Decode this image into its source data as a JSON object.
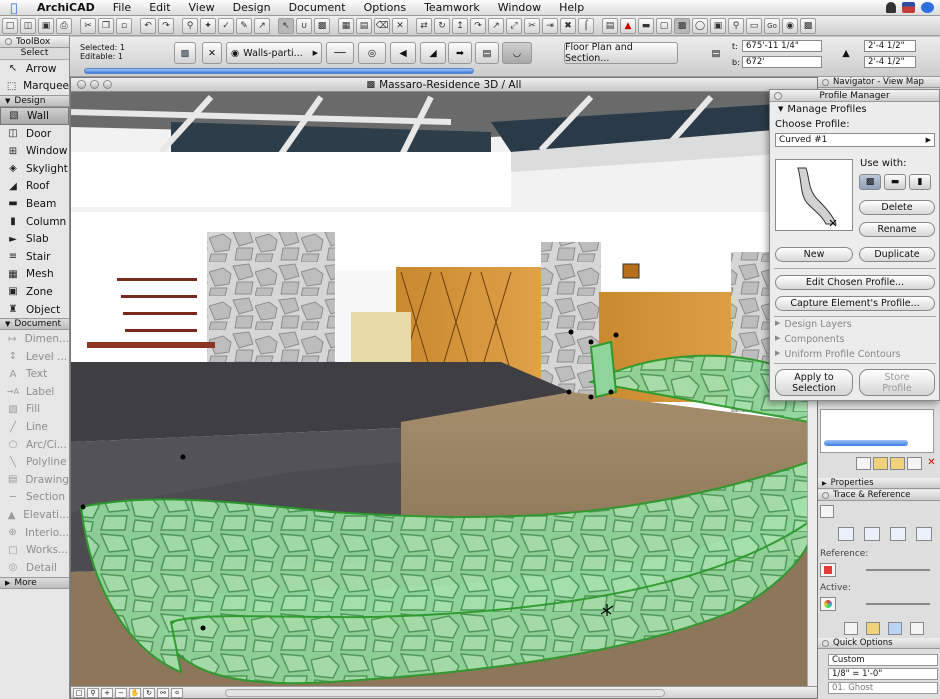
{
  "menubar": {
    "app": "ArchiCAD",
    "items": [
      "File",
      "Edit",
      "View",
      "Design",
      "Document",
      "Options",
      "Teamwork",
      "Window",
      "Help"
    ]
  },
  "infobox": {
    "selected": "Selected: 1",
    "editable": "Editable: 1",
    "layer": "Walls-parti...",
    "view": "Floor Plan and Section...",
    "t_label": "t:",
    "b_label": "b:",
    "t_value": "675'-11 1/4\"",
    "b_value": "672'",
    "dim1": "2'-4 1/2\"",
    "dim2": "2'-4 1/2\""
  },
  "toolbox": {
    "title": "ToolBox",
    "select_label": "Select",
    "top_tools": [
      {
        "label": "Arrow",
        "icon": "↖"
      },
      {
        "label": "Marquee",
        "icon": "⬚"
      }
    ],
    "design_label": "Design",
    "design_tools": [
      {
        "label": "Wall",
        "icon": "▧"
      },
      {
        "label": "Door",
        "icon": "◫"
      },
      {
        "label": "Window",
        "icon": "⊞"
      },
      {
        "label": "Skylight",
        "icon": "◈"
      },
      {
        "label": "Roof",
        "icon": "◢"
      },
      {
        "label": "Beam",
        "icon": "▬"
      },
      {
        "label": "Column",
        "icon": "▮"
      },
      {
        "label": "Slab",
        "icon": "►"
      },
      {
        "label": "Stair",
        "icon": "≡"
      },
      {
        "label": "Mesh",
        "icon": "▦"
      },
      {
        "label": "Zone",
        "icon": "▣"
      },
      {
        "label": "Object",
        "icon": "♜"
      }
    ],
    "document_label": "Document",
    "document_tools": [
      {
        "label": "Dimen...",
        "icon": "↦"
      },
      {
        "label": "Level ...",
        "icon": "↕"
      },
      {
        "label": "Text",
        "icon": "A"
      },
      {
        "label": "Label",
        "icon": "→A"
      },
      {
        "label": "Fill",
        "icon": "▧"
      },
      {
        "label": "Line",
        "icon": "╱"
      },
      {
        "label": "Arc/Ci...",
        "icon": "○"
      },
      {
        "label": "Polyline",
        "icon": "╲"
      },
      {
        "label": "Drawing",
        "icon": "▤"
      },
      {
        "label": "Section",
        "icon": "─"
      },
      {
        "label": "Elevati...",
        "icon": "▲"
      },
      {
        "label": "Interio...",
        "icon": "⊕"
      },
      {
        "label": "Works...",
        "icon": "□"
      },
      {
        "label": "Detail",
        "icon": "◎"
      }
    ],
    "more_label": "More"
  },
  "window3d": {
    "title": "Massaro-Residence 3D / All"
  },
  "navigator": {
    "title": "Navigator - View Map"
  },
  "profile_manager": {
    "title": "Profile Manager",
    "manage_label": "Manage Profiles",
    "choose_label": "Choose Profile:",
    "selected_profile": "Curved #1",
    "use_with_label": "Use with:",
    "delete_label": "Delete",
    "rename_label": "Rename",
    "new_label": "New",
    "duplicate_label": "Duplicate",
    "edit_label": "Edit Chosen Profile...",
    "capture_label": "Capture Element's Profile...",
    "collapsed_sections": [
      "Design Layers",
      "Components",
      "Uniform Profile Contours"
    ],
    "apply_label": "Apply to\nSelection",
    "store_label": "Store\nProfile"
  },
  "right_palettes": {
    "properties_label": "Properties",
    "trace_label": "Trace & Reference",
    "reference_label": "Reference:",
    "active_label": "Active:",
    "quick_label": "Quick Options",
    "scale_mode": "Custom",
    "scale": "1/8\"   =   1'-0\"",
    "layer": "01. Ghost"
  }
}
